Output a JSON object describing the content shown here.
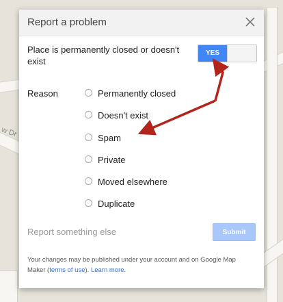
{
  "map": {
    "street_label": "w Dr"
  },
  "dialog": {
    "title": "Report a problem",
    "close_icon": "close-icon",
    "question": "Place is permanently closed or doesn't exist",
    "toggle": {
      "on_label": "YES",
      "state": "on"
    },
    "reason_label": "Reason",
    "options": [
      {
        "label": "Permanently closed",
        "selected": false
      },
      {
        "label": "Doesn't exist",
        "selected": false
      },
      {
        "label": "Spam",
        "selected": false
      },
      {
        "label": "Private",
        "selected": false
      },
      {
        "label": "Moved elsewhere",
        "selected": false
      },
      {
        "label": "Duplicate",
        "selected": false
      }
    ],
    "report_else": "Report something else",
    "submit_label": "Submit",
    "footer": {
      "text_before": "Your changes may be published under your account and on Google Map Maker (",
      "terms_link": "terms of use",
      "text_middle": "). ",
      "learn_more": "Learn more",
      "text_after": "."
    }
  },
  "colors": {
    "accent": "#4285f4",
    "submit_disabled": "#a8c7fa",
    "annotation_arrow": "#b3241b"
  }
}
